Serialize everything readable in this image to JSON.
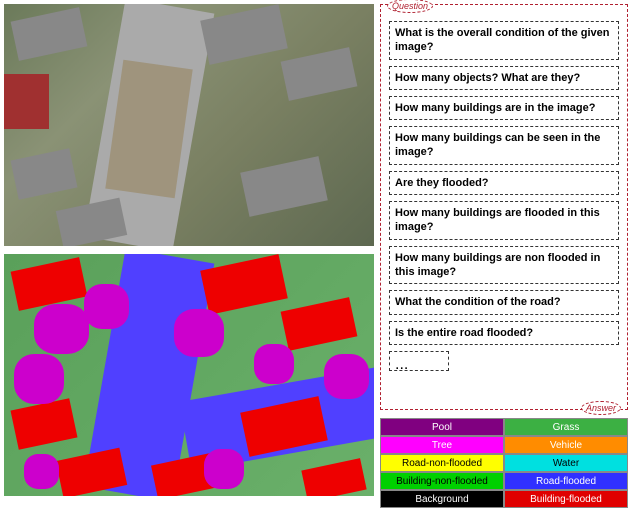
{
  "panel": {
    "question_tag": "Question",
    "answer_tag": "Answer",
    "questions": [
      "What is the overall condition of the given image?",
      "How many objects? What are they?",
      "How many buildings are in the image?",
      "How many buildings can be seen in the image?",
      "Are they flooded?",
      "How many buildings are flooded in this image?",
      "How many buildings are non flooded in this image?",
      "What the condition of the road?",
      "Is the entire road flooded?"
    ],
    "answer_placeholder": "..."
  },
  "legend": {
    "rows": [
      {
        "left": {
          "label": "Pool",
          "color": "purple"
        },
        "right": {
          "label": "Grass",
          "color": "green"
        }
      },
      {
        "left": {
          "label": "Tree",
          "color": "magenta"
        },
        "right": {
          "label": "Vehicle",
          "color": "orange"
        }
      },
      {
        "left": {
          "label": "Road-non-flooded",
          "color": "yellow"
        },
        "right": {
          "label": "Water",
          "color": "cyan"
        }
      },
      {
        "left": {
          "label": "Building-non-flooded",
          "color": "bgreen"
        },
        "right": {
          "label": "Road-flooded",
          "color": "blue"
        }
      },
      {
        "left": {
          "label": "Background",
          "color": "black"
        },
        "right": {
          "label": "Building-flooded",
          "color": "red"
        }
      }
    ]
  },
  "images": {
    "top_alt": "aerial-photo",
    "bottom_alt": "segmentation-map"
  }
}
